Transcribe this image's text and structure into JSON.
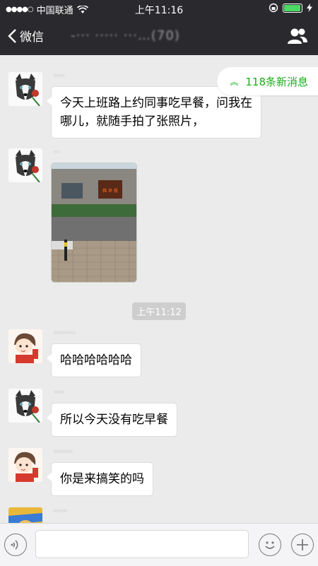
{
  "status_bar": {
    "signal": "●●●●○",
    "carrier": "中国联通",
    "time": "上午11:16"
  },
  "nav": {
    "back_label": "微信",
    "title": "-··· ····· ···…(70)"
  },
  "new_messages_label": "118条新消息",
  "messages": [
    {
      "sender": "····",
      "text": "今天上班路上约同事吃早餐，问我在哪儿，就随手拍了张照片，",
      "avatar_icon": "husky-avatar-icon"
    },
    {
      "sender": "··",
      "type": "image",
      "avatar_icon": "husky-avatar-icon",
      "photo_sign": "稀 早 餐"
    },
    {
      "sender": "········",
      "text": "哈哈哈哈哈哈",
      "avatar_icon": "girl-avatar-icon"
    },
    {
      "sender": "····",
      "text": "所以今天没有吃早餐",
      "avatar_icon": "husky-avatar-icon"
    },
    {
      "sender": "·······",
      "text": "你是来搞笑的吗",
      "avatar_icon": "girl-avatar-icon"
    },
    {
      "sender": "·····",
      "avatar_icon": "cartoon-avatar-icon"
    }
  ],
  "timestamp": "上午11:12",
  "colors": {
    "nav_bg": "#2a2a2e",
    "chat_bg": "#ebebeb",
    "accent_green": "#1aad19",
    "battery_green": "#4cd964"
  }
}
